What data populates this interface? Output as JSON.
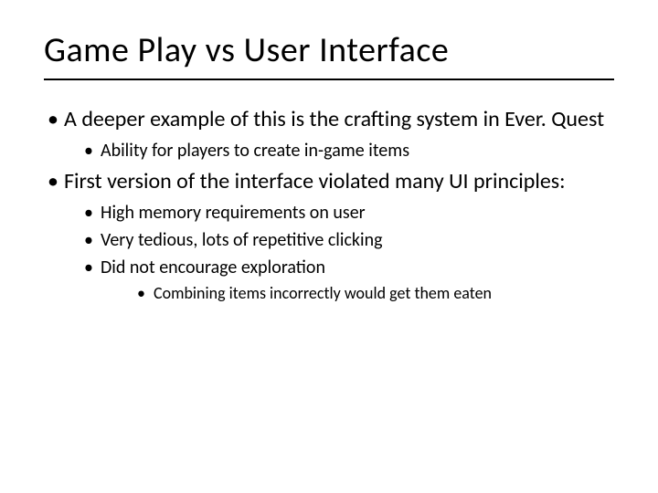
{
  "title": "Game Play vs User Interface",
  "bullets": {
    "b1": "A deeper example of this is the crafting system in Ever. Quest",
    "b1_1": "Ability for players to create in-game items",
    "b2": "First version of the interface violated many UI principles:",
    "b2_1": "High memory requirements on user",
    "b2_2": "Very tedious, lots of repetitive clicking",
    "b2_3": "Did not encourage exploration",
    "b2_3_1": "Combining items incorrectly would get them eaten"
  }
}
